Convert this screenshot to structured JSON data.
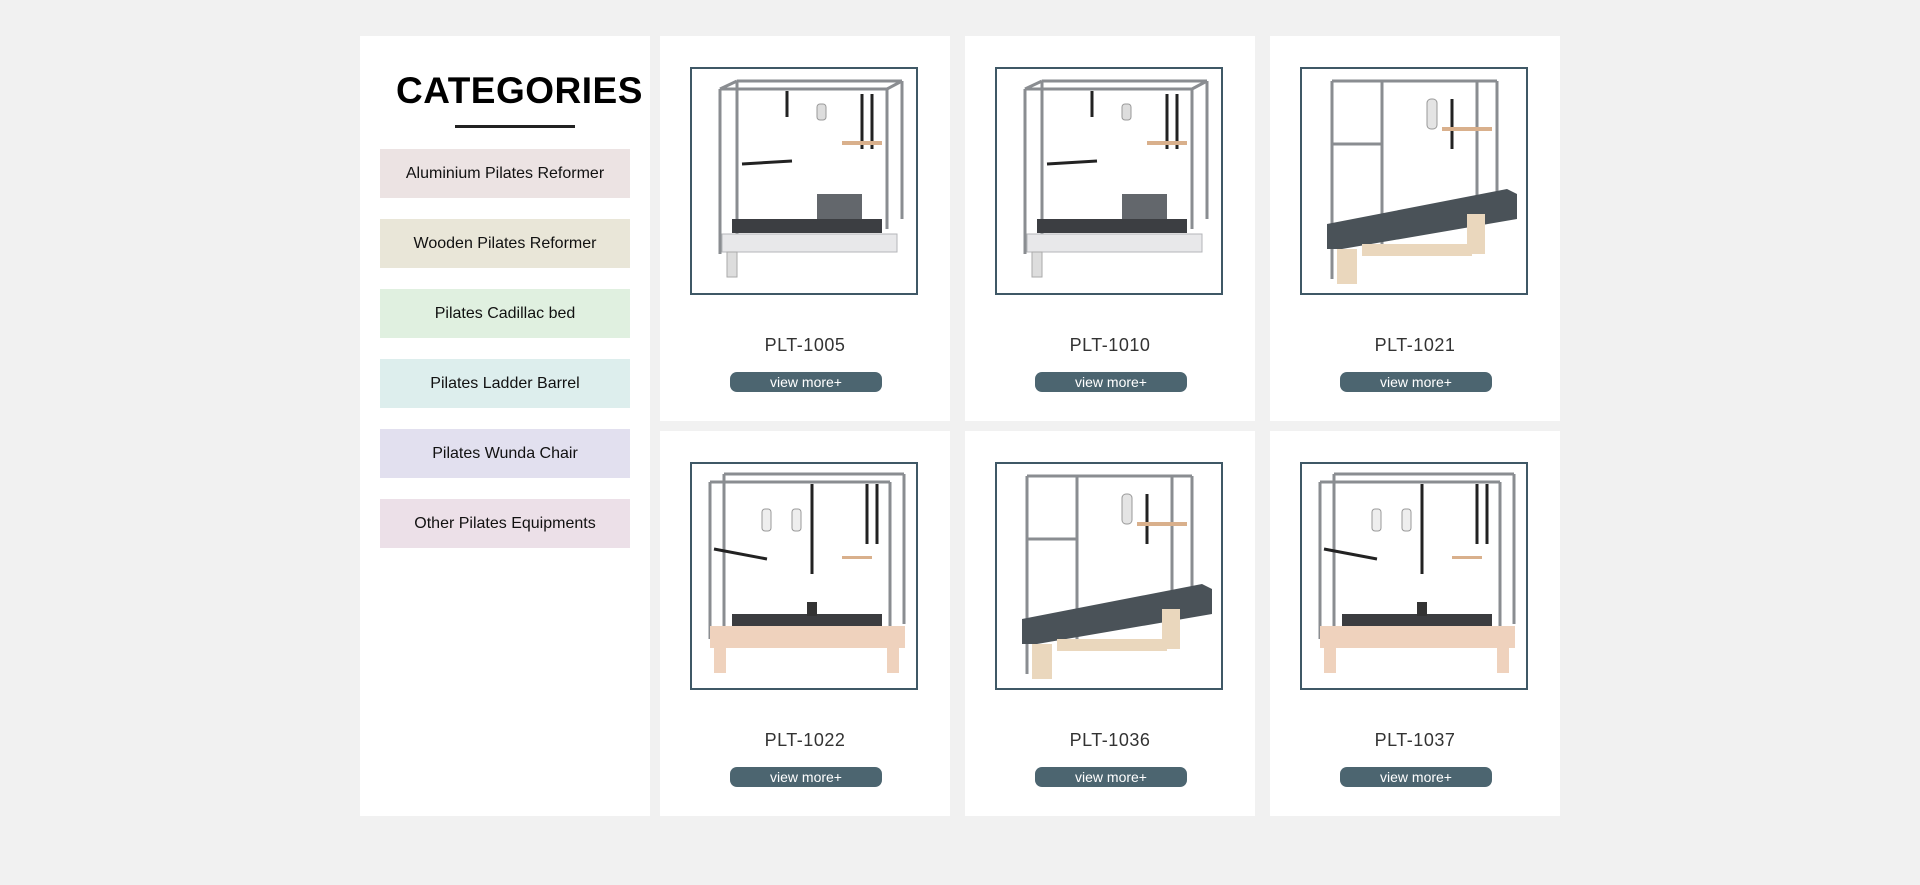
{
  "sidebar": {
    "title": "CATEGORIES",
    "items": [
      {
        "label": "Aluminium Pilates Reformer",
        "color": "#ece3e3"
      },
      {
        "label": "Wooden Pilates Reformer",
        "color": "#e9e6d8"
      },
      {
        "label": "Pilates Cadillac bed",
        "color": "#e0f0e0"
      },
      {
        "label": "Pilates Ladder Barrel",
        "color": "#ddeeed"
      },
      {
        "label": "Pilates Wunda Chair",
        "color": "#e2e0ef"
      },
      {
        "label": "Other Pilates Equipments",
        "color": "#ece0e8"
      }
    ]
  },
  "products": [
    {
      "code": "PLT-1005",
      "button": "view more+",
      "image": "aluminium-reformer-with-tower"
    },
    {
      "code": "PLT-1010",
      "button": "view more+",
      "image": "aluminium-reformer-with-tower"
    },
    {
      "code": "PLT-1021",
      "button": "view more+",
      "image": "cadillac-bed-wooden"
    },
    {
      "code": "PLT-1022",
      "button": "view more+",
      "image": "wooden-reformer-with-tower"
    },
    {
      "code": "PLT-1036",
      "button": "view more+",
      "image": "cadillac-bed-wooden"
    },
    {
      "code": "PLT-1037",
      "button": "view more+",
      "image": "wooden-reformer-with-tower"
    }
  ],
  "colors": {
    "page_bg": "#f1f1f1",
    "card_bg": "#ffffff",
    "frame_border": "#3f5866",
    "button_bg": "#4c6570"
  }
}
